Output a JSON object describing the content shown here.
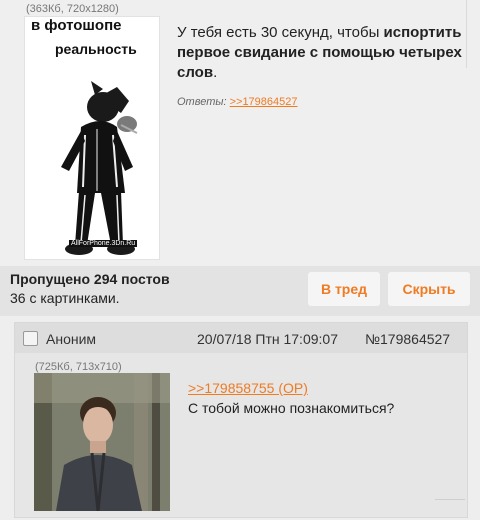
{
  "op": {
    "file_info": "(363Кб, 720x1280)",
    "meme_top": "в фотошопе",
    "meme_mid": "реальность",
    "meme_watermark": "AllForPhone.3Dn.Ru",
    "text_lead": "У тебя есть 30 секунд, чтобы",
    "text_bold": "испортить первое свидание с помощью четырех слов",
    "text_tail": ".",
    "replies_label": "Ответы:",
    "replies_link": ">>179864527"
  },
  "omitted": {
    "line1": "Пропущено 294 постов",
    "line2": "36 с картинками.",
    "thread_button": "В тред",
    "hide_button": "Скрыть"
  },
  "reply": {
    "name": "Аноним",
    "date": "20/07/18 Птн 17:09:07",
    "number": "№179864527",
    "file_info": "(725Кб, 713x710)",
    "quote_link": ">>179858755 (OP)",
    "text": "С тобой можно познакомиться?"
  },
  "colors": {
    "accent": "#ef7b23",
    "background": "#eeeeee"
  }
}
